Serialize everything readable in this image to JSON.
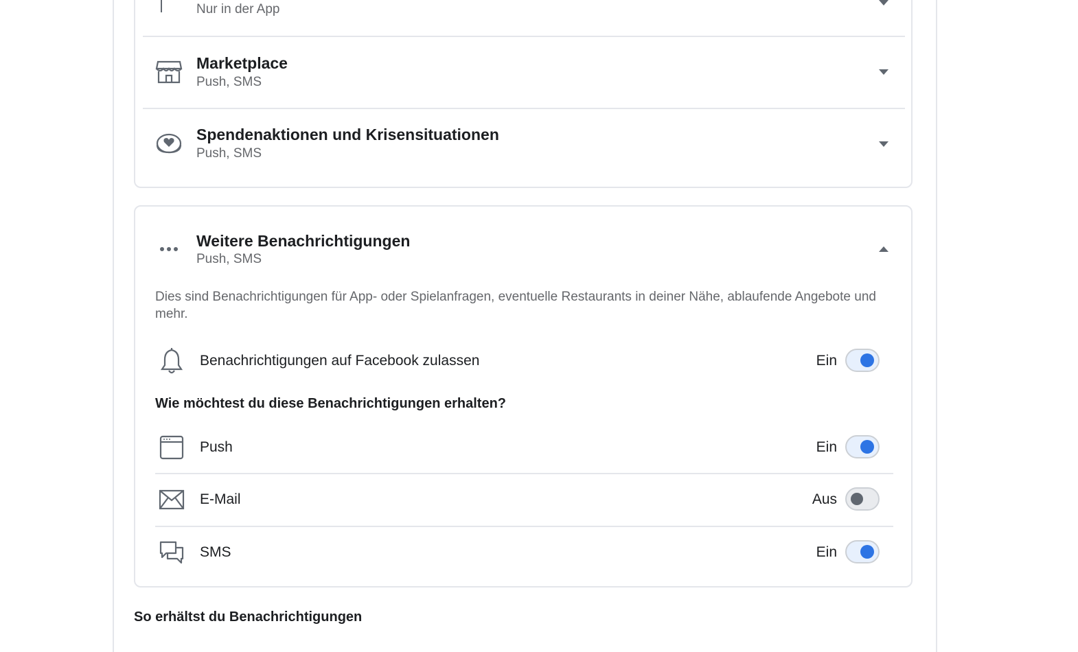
{
  "categories": [
    {
      "title": "",
      "subtitle": "Nur in der App",
      "icon": "flag-icon"
    },
    {
      "title": "Marketplace",
      "subtitle": "Push, SMS",
      "icon": "storefront-icon"
    },
    {
      "title": "Spendenaktionen und Krisensituationen",
      "subtitle": "Push, SMS",
      "icon": "heart-coin-icon"
    }
  ],
  "more": {
    "title": "Weitere Benachrichtigungen",
    "subtitle": "Push, SMS",
    "icon": "more-dots-icon",
    "description": "Dies sind Benachrichtigungen für App- oder Spielanfragen, eventuelle Restaurants in deiner Nähe, ablaufende Angebote und mehr.",
    "allow": {
      "label": "Benachrichtigungen auf Facebook zulassen",
      "state": "Ein",
      "on": true,
      "icon": "bell-icon"
    },
    "question": "Wie möchtest du diese Benachrichtigungen erhalten?",
    "channels": [
      {
        "label": "Push",
        "state": "Ein",
        "on": true,
        "icon": "browser-window-icon"
      },
      {
        "label": "E-Mail",
        "state": "Aus",
        "on": false,
        "icon": "envelope-icon"
      },
      {
        "label": "SMS",
        "state": "Ein",
        "on": true,
        "icon": "chat-bubbles-icon"
      }
    ]
  },
  "footer": {
    "title": "So erhältst du Benachrichtigungen"
  },
  "colors": {
    "toggle_on": "#2d74e4",
    "toggle_off": "#606770",
    "divider": "#e4e6eb",
    "secondary_text": "#65676b"
  }
}
